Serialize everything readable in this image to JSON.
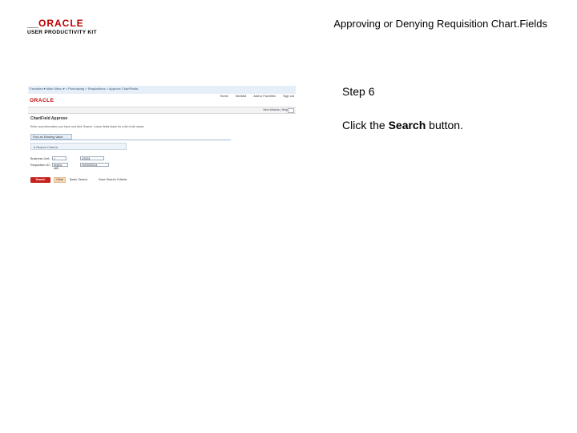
{
  "logo": {
    "brand": "ORACLE",
    "tagline": "USER PRODUCTIVITY KIT"
  },
  "document_title": "Approving or Denying Requisition Chart.Fields",
  "step": {
    "label": "Step 6"
  },
  "instruction": {
    "prefix": "Click the ",
    "target": "Search",
    "suffix": " button."
  },
  "screenshot": {
    "breadcrumb": "Favorites  ▾  Main Menu  ▾  > Purchasing  > Requisitions  > Approve ChartFields",
    "brand": "ORACLE",
    "nav_links": [
      "Home",
      "Worklist",
      "Add to Favorites",
      "Sign out"
    ],
    "sub_links": "New Window | Help",
    "page_heading": "ChartField Approve",
    "instructions": "Enter any information you have and click Search. Leave fields blank for a list of all values.",
    "tab_label": "Find an Existing Value",
    "criteria_label": "▾ Search Criteria",
    "fields": [
      {
        "label": "Business Unit:",
        "operator": "=",
        "value": "US001"
      },
      {
        "label": "Requisition ID:",
        "operator": "begins with",
        "value": "0000000014"
      }
    ],
    "search_button": "Search",
    "clear_button": "Clear",
    "basic_search_link": "Basic Search",
    "save_criteria_link": "Save Search Criteria"
  }
}
